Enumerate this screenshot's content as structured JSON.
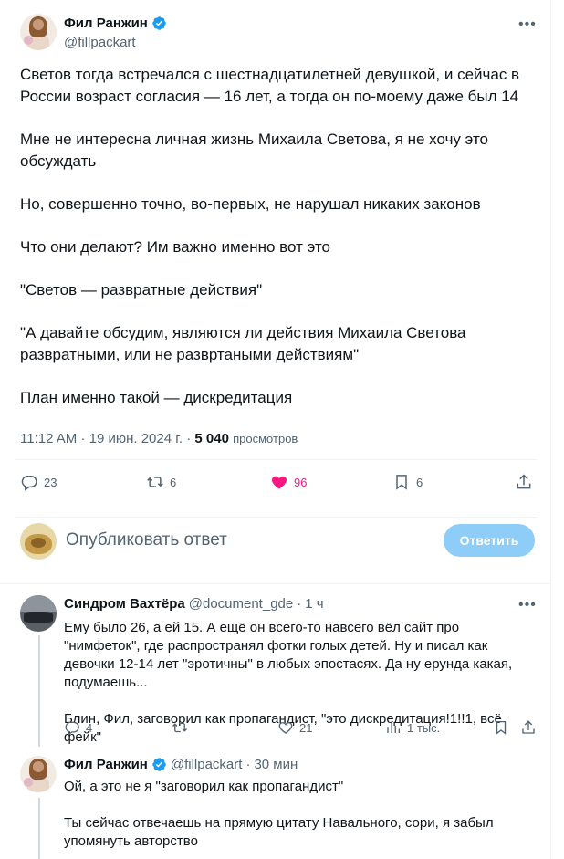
{
  "main_tweet": {
    "author_name": "Фил Ранжин",
    "author_handle": "@fillpackart",
    "paragraphs": [
      "Светов тогда встречался с шестнадцатилетней девушкой, и сейчас в России возраст согласия — 16 лет, а тогда он по-моему даже был 14",
      "Мне не интересна личная жизнь Михаила Светова, я не хочу это обсуждать",
      "Но, совершенно точно, во-первых, не нарушал никаких законов",
      "Что они делают? Им важно именно вот это",
      "\"Светов — развратные действия\"",
      "\"А давайте обсудим, являются ли действия Михаила Светова развратными, или не развртаными действиям\"",
      "План именно такой — дискредитация"
    ],
    "time": "11:12 AM",
    "sep1": "·",
    "date": "19 июн. 2024 г.",
    "sep2": "·",
    "views_count": "5 040",
    "views_label": "просмотров",
    "replies": "23",
    "reposts": "6",
    "likes": "96",
    "bookmarks": "6"
  },
  "composer": {
    "placeholder": "Опубликовать ответ",
    "button_label": "Ответить"
  },
  "replies": [
    {
      "author_name": "Синдром Вахтёра",
      "author_handle": "@document_gde",
      "sep": "·",
      "time": "1 ч",
      "paragraphs": [
        "Ему было 26, а ей 15. А ещё он всего-то навсего вёл сайт про \"нимфеток\", где распространял фотки голых детей. Ну и писал как девочки 12-14 лет \"эротичны\" в любых эпостасях. Да ну ерунда какая, подумаешь...",
        "Блин, Фил, заговорил как пропагандист, \"это дискредитация!1!!1, всё фейк\""
      ],
      "replies": "4",
      "reposts": "",
      "likes": "21",
      "views": "1 тыс."
    },
    {
      "author_name": "Фил Ранжин",
      "author_handle": "@fillpackart",
      "sep": "·",
      "time": "30 мин",
      "paragraphs": [
        "Ой, а это не я \"заговорил как пропагандист\"",
        "Ты сейчас отвечаешь на прямую цитату Навального, сори, я забыл упомянуть авторство"
      ]
    }
  ],
  "colors": {
    "accent": "#1d9bf0",
    "like": "#f91880",
    "secondary_text": "#536471",
    "button_disabled": "#8ecdf8"
  }
}
